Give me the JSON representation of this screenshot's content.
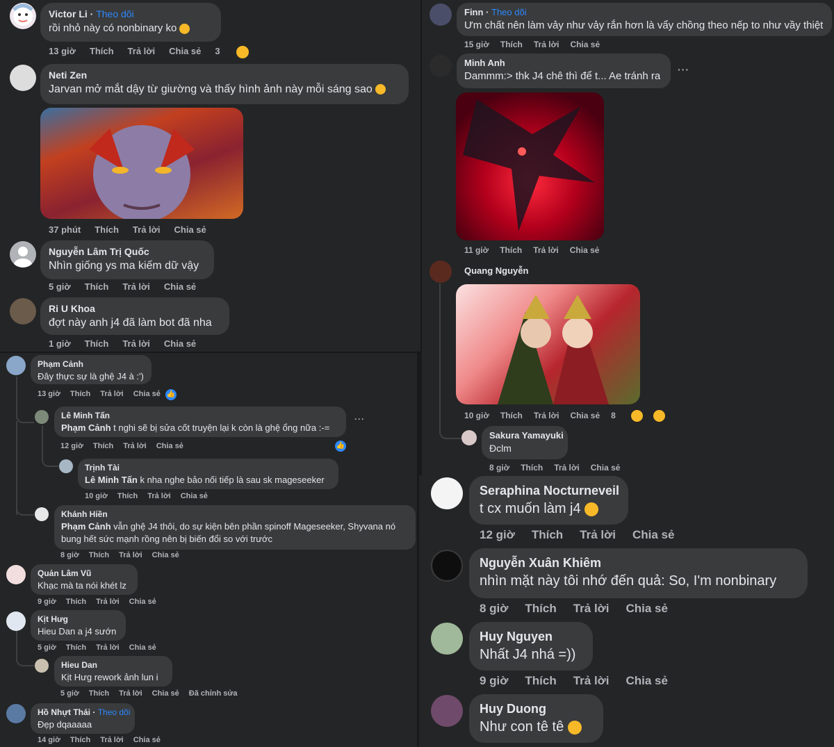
{
  "labels": {
    "like": "Thích",
    "reply": "Trả lời",
    "share": "Chia sẻ",
    "follow": "Theo dõi",
    "edited": "Đã chỉnh sửa",
    "more": "···"
  },
  "panel_a": {
    "c1": {
      "name": "Victor Li",
      "text": "rồi nhỏ này có nonbinary ko",
      "time": "13 giờ",
      "reactions": "3"
    },
    "c2": {
      "name": "Neti Zen",
      "text": "Jarvan mở mắt dậy từ giường và thấy hình ảnh này mỗi sáng sao",
      "time": "37 phút"
    },
    "c3": {
      "name": "Nguyễn Lâm Trị Quốc",
      "text": "Nhìn giống ys ma kiếm dữ vậy",
      "time": "5 giờ"
    },
    "c4": {
      "name": "Ri U Khoa",
      "text": "đợt này anh j4 đã làm bot đã nha",
      "time": "1 giờ"
    }
  },
  "panel_b": {
    "c1": {
      "name": "Phạm Cảnh",
      "text": "Đây thực sự là ghệ J4 à :')",
      "time": "13 giờ"
    },
    "c2": {
      "name": "Lê Minh Tấn",
      "tag": "Phạm Cảnh",
      "text": " t nghi sẽ bị sửa cốt truyện lại k còn là ghệ ổng nữa :-=",
      "time": "12 giờ"
    },
    "c3": {
      "name": "Trịnh Tài",
      "tag": "Lê Minh Tấn",
      "text": " k nha nghe bảo nối tiếp là sau sk mageseeker",
      "time": "10 giờ"
    },
    "c4": {
      "name": "Khánh Hiền",
      "tag": "Phạm Cảnh",
      "text1": " vẫn ghệ J4 thôi, do sự kiện bên phần spinoff Mageseeker, Shyvana nó",
      "text2": "bung hết sức mạnh rồng nên bị biến đổi so với trước",
      "time": "8 giờ"
    },
    "c5": {
      "name": "Quản Lâm Vũ",
      "text": "Khạc mà ta nói khét lz",
      "time": "9 giờ"
    },
    "c6": {
      "name": "Kịt Hưg",
      "text": "Hieu Dan a j4 sướn",
      "time": "5 giờ"
    },
    "c7": {
      "name": "Hieu Dan",
      "text": "Kịt Hưg rework ảnh lun i",
      "time": "5 giờ"
    },
    "c8": {
      "name": "Hồ Nhựt Thái",
      "text": "Đẹp dqaaaaa",
      "time": "14 giờ"
    }
  },
  "panel_c": {
    "c1": {
      "name": "Finn",
      "text": "Ưm chất nên làm vảy như vảy rắn hơn là vẩy chồng theo nếp to như vầy thiệt",
      "time": "15 giờ"
    },
    "c2": {
      "name": "Minh Anh",
      "text": "Dammm:> thk J4 chê thì để t... Ae tránh ra",
      "time": "11 giờ"
    },
    "c3": {
      "name": "Quang Nguyễn",
      "time": "10 giờ",
      "reactions": "8"
    },
    "c4": {
      "name": "Sakura Yamayuki",
      "text": "Đclm",
      "time": "8 giờ"
    }
  },
  "panel_d": {
    "c1": {
      "name": "Seraphina Nocturneveil",
      "text": "t cx muốn làm j4",
      "time": "12 giờ"
    },
    "c2": {
      "name": "Nguyễn Xuân Khiêm",
      "text": "nhìn mặt này tôi nhớ đến quả: So, I'm nonbinary",
      "time": "8 giờ"
    },
    "c3": {
      "name": "Huy Nguyen",
      "text": "Nhất J4 nhá =))",
      "time": "9 giờ"
    },
    "c4": {
      "name": "Huy Duong",
      "text": "Như con tê tê",
      "time": "9 giờ"
    }
  },
  "icons": [
    "smirk-emoji-icon",
    "pacman-emoji-icon",
    "laugh-emoji-icon",
    "like-icon",
    "tongue-emoji-icon",
    "smile-emoji-icon"
  ]
}
